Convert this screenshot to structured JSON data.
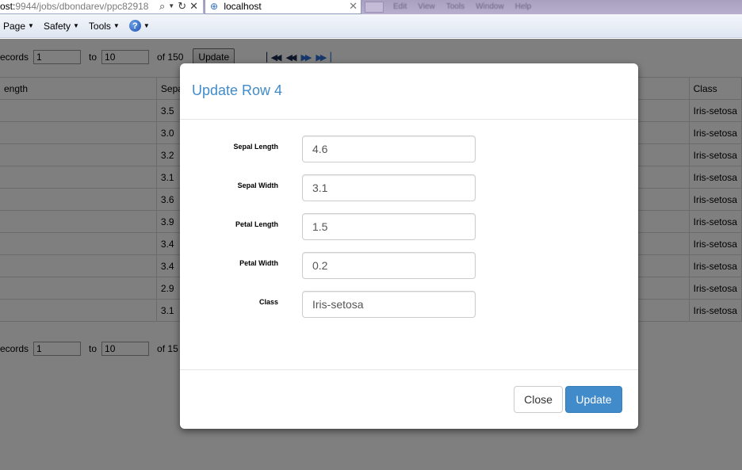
{
  "browser": {
    "address_host": "ost:",
    "address_path": "9944/jobs/dbondarev/ppc82918",
    "tab_title": "localhost",
    "ghost_menu": [
      "Edit",
      "View",
      "Tools",
      "Window",
      "Help"
    ],
    "commands": [
      {
        "label": "Page"
      },
      {
        "label": "Safety"
      },
      {
        "label": "Tools"
      }
    ]
  },
  "pager_top": {
    "records_label": "ecords",
    "from_value": "1",
    "to_label": "to",
    "to_value": "10",
    "of_label": "of 150",
    "update_label": "Update"
  },
  "pager_bottom": {
    "records_label": "ecords",
    "from_value": "1",
    "to_label": "to",
    "to_value": "10",
    "of_label": "of 15"
  },
  "table": {
    "headers": [
      "ength",
      "Sepa",
      "",
      "Class"
    ],
    "rows": [
      [
        "",
        "3.5",
        "",
        "Iris-setosa"
      ],
      [
        "",
        "3.0",
        "",
        "Iris-setosa"
      ],
      [
        "",
        "3.2",
        "",
        "Iris-setosa"
      ],
      [
        "",
        "3.1",
        "",
        "Iris-setosa"
      ],
      [
        "",
        "3.6",
        "",
        "Iris-setosa"
      ],
      [
        "",
        "3.9",
        "",
        "Iris-setosa"
      ],
      [
        "",
        "3.4",
        "",
        "Iris-setosa"
      ],
      [
        "",
        "3.4",
        "",
        "Iris-setosa"
      ],
      [
        "",
        "2.9",
        "",
        "Iris-setosa"
      ],
      [
        "",
        "3.1",
        "",
        "Iris-setosa"
      ]
    ]
  },
  "modal": {
    "title": "Update Row 4",
    "fields": [
      {
        "label": "Sepal Length",
        "value": "4.6"
      },
      {
        "label": "Sepal Width",
        "value": "3.1"
      },
      {
        "label": "Petal Length",
        "value": "1.5"
      },
      {
        "label": "Petal Width",
        "value": "0.2"
      },
      {
        "label": "Class",
        "value": "Iris-setosa"
      }
    ],
    "close_label": "Close",
    "update_label": "Update"
  },
  "colors": {
    "modal_title": "#428bca",
    "primary_button": "#428bca",
    "overlay": "rgba(0,0,0,0.5)"
  }
}
